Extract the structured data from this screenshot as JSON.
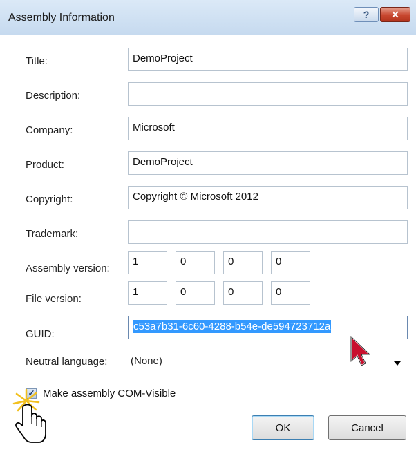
{
  "window": {
    "title": "Assembly Information",
    "help_glyph": "?",
    "close_glyph": "✕"
  },
  "labels": {
    "title": "Title:",
    "description": "Description:",
    "company": "Company:",
    "product": "Product:",
    "copyright": "Copyright:",
    "trademark": "Trademark:",
    "assembly_version": "Assembly version:",
    "file_version": "File version:",
    "guid": "GUID:",
    "neutral_language": "Neutral language:"
  },
  "values": {
    "title": "DemoProject",
    "description": "",
    "company": "Microsoft",
    "product": "DemoProject",
    "copyright": "Copyright © Microsoft 2012",
    "trademark": "",
    "assembly_version": [
      "1",
      "0",
      "0",
      "0"
    ],
    "file_version": [
      "1",
      "0",
      "0",
      "0"
    ],
    "guid": "c53a7b31-6c60-4288-b54e-de594723712a",
    "neutral_language": "(None)"
  },
  "com_visible": {
    "label": "Make assembly COM-Visible",
    "checked": true,
    "check_glyph": "✓"
  },
  "buttons": {
    "ok": "OK",
    "cancel": "Cancel"
  },
  "colors": {
    "selection": "#3399ff",
    "titlebar": "#c6daef"
  },
  "icons": [
    "help-icon",
    "close-icon",
    "dropdown-arrow-icon",
    "arrow-cursor-icon",
    "hand-cursor-icon"
  ]
}
